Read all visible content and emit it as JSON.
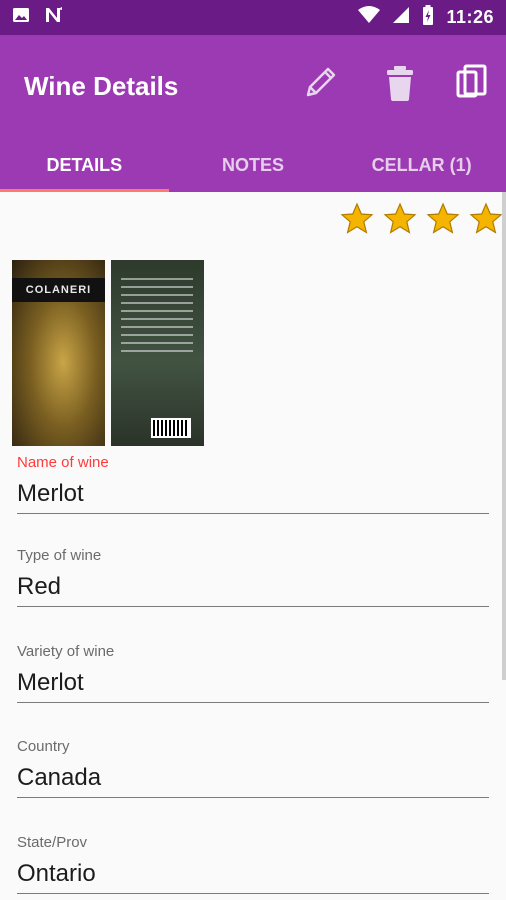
{
  "status_bar": {
    "time": "11:26",
    "left_icons": [
      "image-icon",
      "n-notification-icon"
    ],
    "right_icons": [
      "wifi-icon",
      "signal-icon",
      "battery-icon"
    ]
  },
  "app_bar": {
    "title": "Wine Details",
    "actions": [
      "edit-icon",
      "delete-icon",
      "copy-icon"
    ]
  },
  "tabs": [
    {
      "label": "DETAILS",
      "active": true
    },
    {
      "label": "NOTES",
      "active": false
    },
    {
      "label": "CELLAR (1)",
      "active": false
    }
  ],
  "rating": {
    "stars_visible": 4
  },
  "photos": {
    "front_label": "COLANERI"
  },
  "fields": [
    {
      "label": "Name of wine",
      "value": "Merlot"
    },
    {
      "label": "Type of wine",
      "value": "Red"
    },
    {
      "label": "Variety of wine",
      "value": "Merlot"
    },
    {
      "label": "Country",
      "value": "Canada"
    },
    {
      "label": "State/Prov",
      "value": "Ontario"
    }
  ],
  "colors": {
    "status_bar": "#6a1b86",
    "app_bar": "#9c3ab3",
    "tab_indicator": "#ff7a6e",
    "accent_label": "#ff3b3b",
    "star": "#f5b400"
  }
}
